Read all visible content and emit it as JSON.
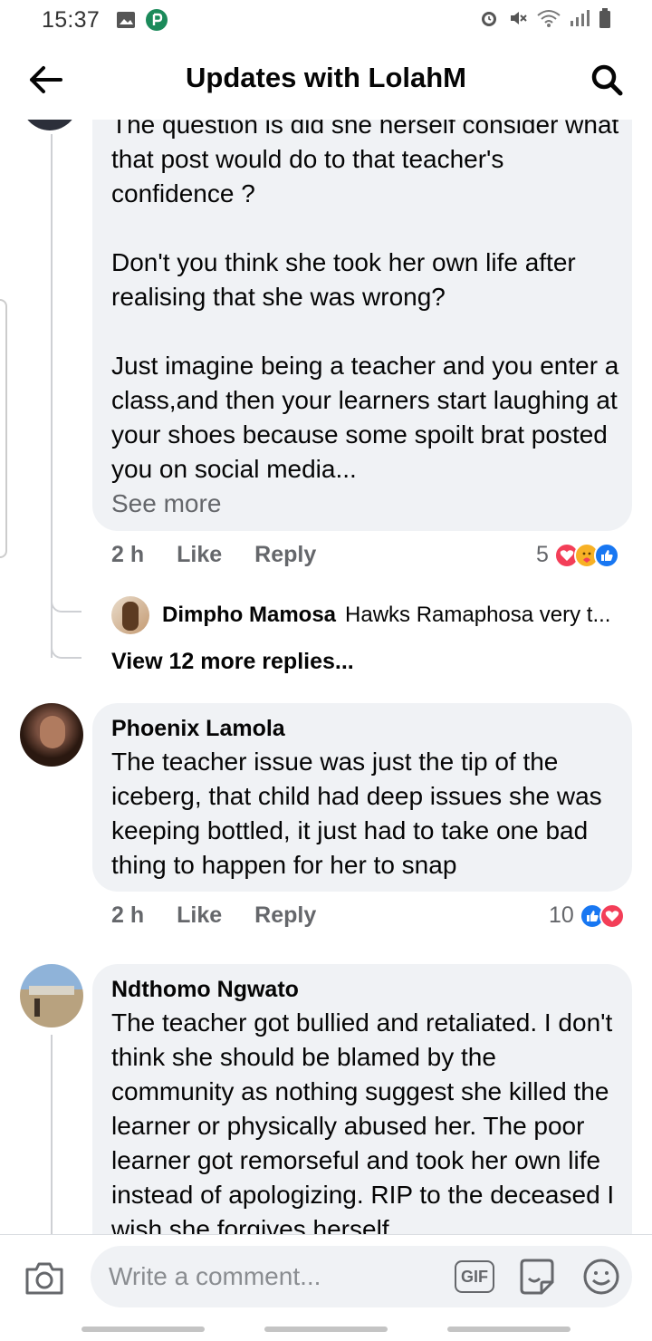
{
  "status_bar": {
    "time": "15:37"
  },
  "header": {
    "title": "Updates with LolahM"
  },
  "comment1": {
    "text": "The question is did she herself consider what that post would do to that teacher's confidence ?\n\nDon't you think she took her own life after realising that she was wrong?\n\nJust imagine being a teacher and you enter a class,and then your learners start laughing at your shoes because some spoilt brat posted you on social media...",
    "see_more": "See more",
    "time": "2 h",
    "like": "Like",
    "reply": "Reply",
    "reaction_count": "5",
    "reactions": [
      "love-icon",
      "care-icon",
      "like-icon"
    ]
  },
  "reply_preview": {
    "author": "Dimpho Mamosa",
    "text": "Hawks Ramaphosa very t..."
  },
  "view_more": "View 12 more replies...",
  "comment2": {
    "author": "Phoenix Lamola",
    "text": "The teacher issue was just the tip of the iceberg, that child had deep issues she was keeping bottled, it just had to take one bad thing to happen for her to snap",
    "time": "2 h",
    "like": "Like",
    "reply": "Reply",
    "reaction_count": "10",
    "reactions": [
      "like-icon",
      "love-icon"
    ]
  },
  "comment3": {
    "author": "Ndthomo Ngwato",
    "text": "The teacher got bullied and retaliated. I don't think she should be blamed by the community as nothing suggest she killed the learner or physically abused her. The poor learner got remorseful and took her own life instead of apologizing. RIP to the deceased I wish she forgives herself"
  },
  "composer": {
    "placeholder": "Write a comment...",
    "gif_label": "GIF"
  },
  "colors": {
    "bubble": "#f0f2f5",
    "like_blue": "#1877f2",
    "love_red": "#f33e58",
    "muted": "#65676b"
  }
}
